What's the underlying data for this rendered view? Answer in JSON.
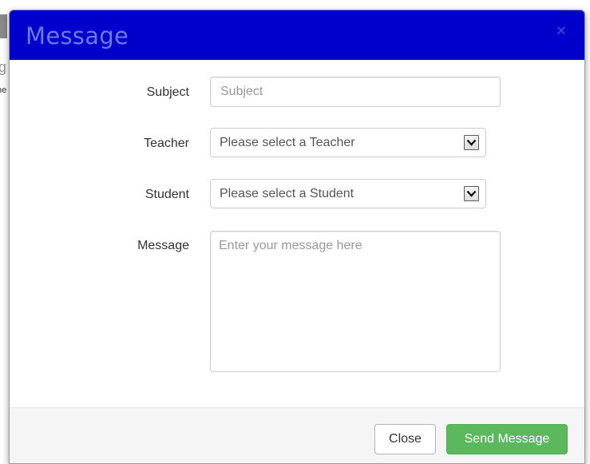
{
  "background_page": {
    "fragment_1": "g",
    "fragment_2": "ne"
  },
  "modal": {
    "title": "Message",
    "close_icon": "×",
    "fields": {
      "subject": {
        "label": "Subject",
        "placeholder": "Subject",
        "value": ""
      },
      "teacher": {
        "label": "Teacher",
        "selected": "Please select a Teacher"
      },
      "student": {
        "label": "Student",
        "selected": "Please select a Student"
      },
      "message": {
        "label": "Message",
        "placeholder": "Enter your message here",
        "value": ""
      }
    },
    "footer": {
      "close_label": "Close",
      "send_label": "Send Message"
    }
  },
  "colors": {
    "header_bg": "#0000cc",
    "title_text": "#6f78e0",
    "send_button": "#5cb85c",
    "footer_bg": "#f5f5f5"
  },
  "icons": {
    "close": "close-icon",
    "dropdown": "chevron-down-icon"
  }
}
